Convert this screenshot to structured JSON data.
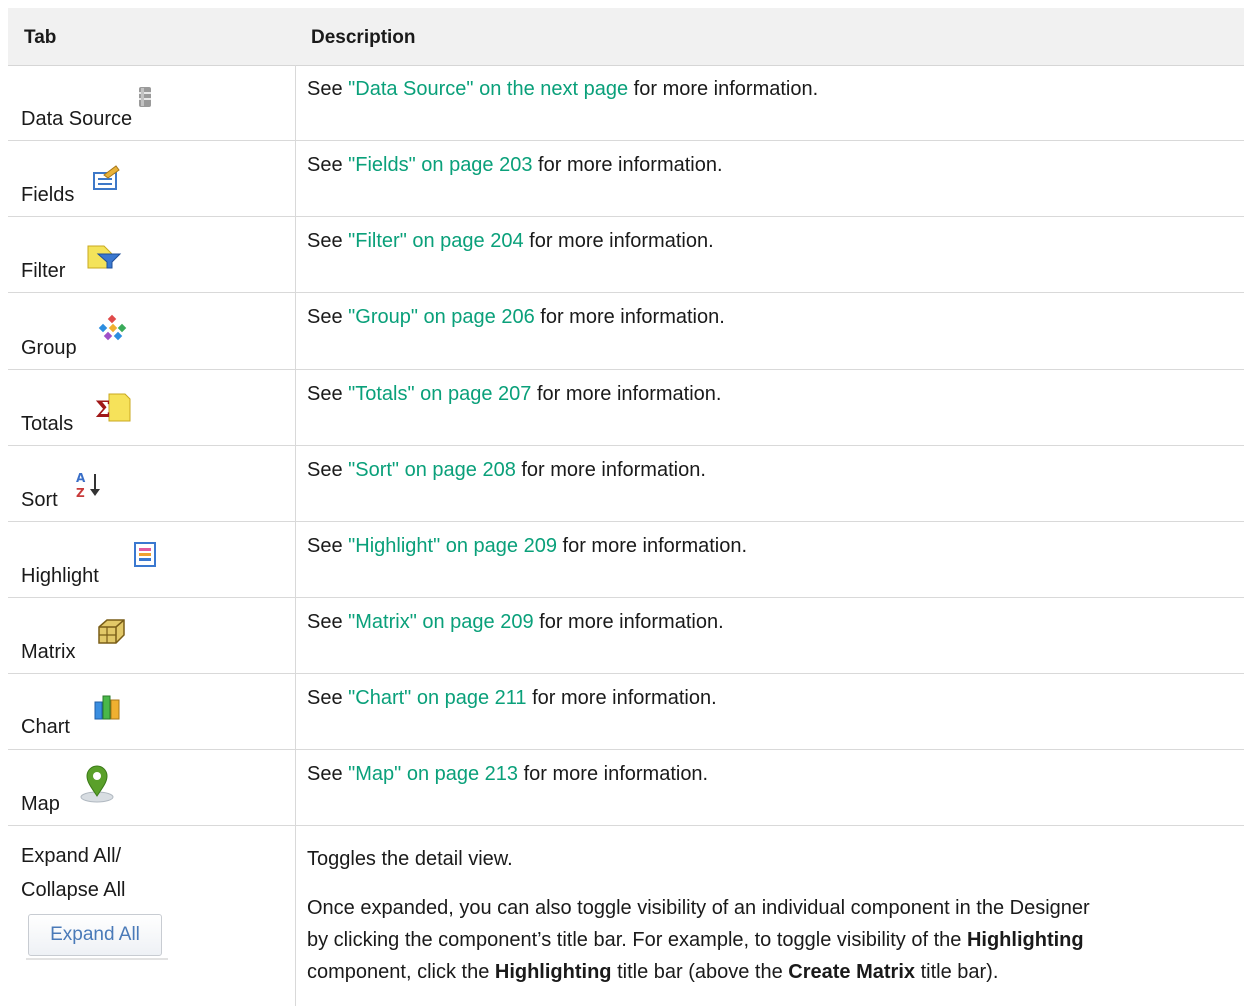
{
  "header": {
    "col_tab": "Tab",
    "col_description": "Description"
  },
  "rows": [
    {
      "label": "Data Source",
      "icon": "database-icon",
      "pre": "See ",
      "link": "\"Data Source\" on the next page",
      "post": " for more information."
    },
    {
      "label": "Fields",
      "icon": "fields-icon",
      "pre": "See ",
      "link": "\"Fields\" on page 203",
      "post": " for more information."
    },
    {
      "label": "Filter",
      "icon": "filter-icon",
      "pre": "See ",
      "link": "\"Filter\" on page 204",
      "post": " for more information."
    },
    {
      "label": "Group",
      "icon": "group-icon",
      "pre": "See ",
      "link": "\"Group\" on page 206",
      "post": " for more information."
    },
    {
      "label": "Totals",
      "icon": "sigma-icon",
      "pre": "See ",
      "link": "\"Totals\" on page 207",
      "post": " for more information."
    },
    {
      "label": "Sort",
      "icon": "sort-az-icon",
      "pre": "See ",
      "link": "\"Sort\" on page 208",
      "post": " for more information."
    },
    {
      "label": "Highlight",
      "icon": "highlight-icon",
      "pre": "See ",
      "link": "\"Highlight\" on page 209",
      "post": " for more information."
    },
    {
      "label": "Matrix",
      "icon": "matrix-icon",
      "pre": "See ",
      "link": "\"Matrix\" on page 209",
      "post": " for more information."
    },
    {
      "label": "Chart",
      "icon": "chart-icon",
      "pre": "See ",
      "link": "\"Chart\" on page 211",
      "post": " for more information."
    },
    {
      "label": "Map",
      "icon": "map-pin-icon",
      "pre": "See ",
      "link": "\"Map\" on page 213",
      "post": " for more information."
    }
  ],
  "expand_row": {
    "label_line1": "Expand All/",
    "label_line2": "Collapse All",
    "button_label": "Expand All",
    "desc1": "Toggles the detail view.",
    "p_line1": "Once expanded, you can also toggle visibility of an individual component in the Designer",
    "p_line2_a": "by clicking the component’s title bar. For example, to toggle visibility of the ",
    "p_line2_b": "Highlighting",
    "p_line3_a": "component, click the ",
    "p_line3_b": "Highlighting",
    "p_line3_c": " title bar (above the ",
    "p_line3_d": "Create Matrix",
    "p_line3_e": " title bar)."
  },
  "colors": {
    "link": "#0aa07a",
    "header_bg": "#f1f1f1",
    "border": "#d9d9d9"
  }
}
